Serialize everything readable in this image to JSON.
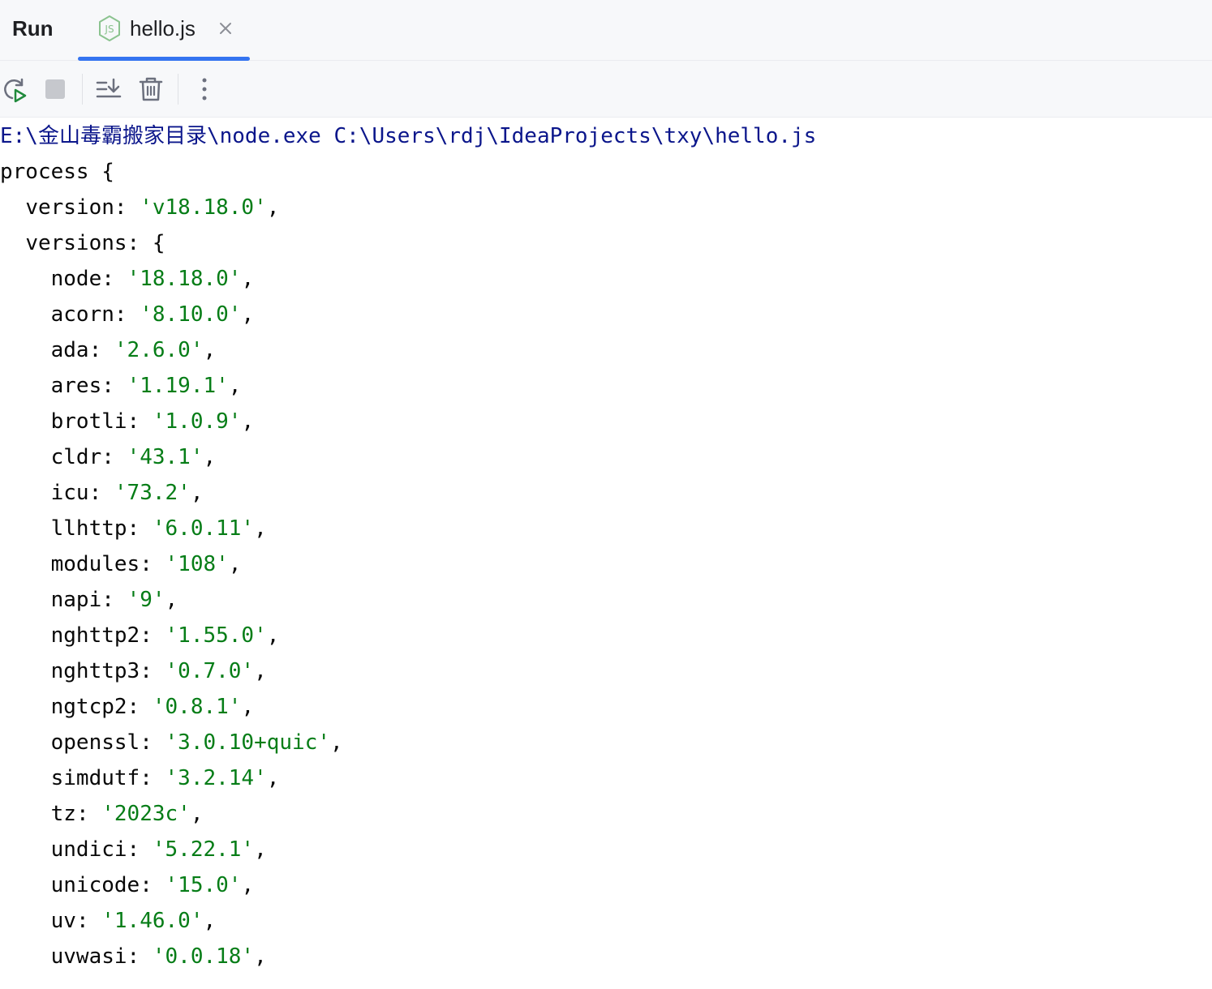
{
  "header": {
    "run_label": "Run",
    "tab": {
      "label": "hello.js",
      "icon": "nodejs-icon"
    }
  },
  "toolbar": {
    "buttons": [
      "rerun-icon",
      "stop-icon",
      "scroll-to-end-icon",
      "clear-all-icon",
      "more-icon"
    ]
  },
  "console": {
    "command": "E:\\金山毒霸搬家目录\\node.exe C:\\Users\\rdj\\IdeaProjects\\txy\\hello.js",
    "process_open": "process {",
    "version": {
      "key": "version",
      "value": "'v18.18.0'"
    },
    "versions_open": "versions: {",
    "entries": [
      {
        "key": "node",
        "value": "'18.18.0'"
      },
      {
        "key": "acorn",
        "value": "'8.10.0'"
      },
      {
        "key": "ada",
        "value": "'2.6.0'"
      },
      {
        "key": "ares",
        "value": "'1.19.1'"
      },
      {
        "key": "brotli",
        "value": "'1.0.9'"
      },
      {
        "key": "cldr",
        "value": "'43.1'"
      },
      {
        "key": "icu",
        "value": "'73.2'"
      },
      {
        "key": "llhttp",
        "value": "'6.0.11'"
      },
      {
        "key": "modules",
        "value": "'108'"
      },
      {
        "key": "napi",
        "value": "'9'"
      },
      {
        "key": "nghttp2",
        "value": "'1.55.0'"
      },
      {
        "key": "nghttp3",
        "value": "'0.7.0'"
      },
      {
        "key": "ngtcp2",
        "value": "'0.8.1'"
      },
      {
        "key": "openssl",
        "value": "'3.0.10+quic'"
      },
      {
        "key": "simdutf",
        "value": "'3.2.14'"
      },
      {
        "key": "tz",
        "value": "'2023c'"
      },
      {
        "key": "undici",
        "value": "'5.22.1'"
      },
      {
        "key": "unicode",
        "value": "'15.0'"
      },
      {
        "key": "uv",
        "value": "'1.46.0'"
      },
      {
        "key": "uvwasi",
        "value": "'0.0.18'"
      }
    ],
    "colors": {
      "command": "#0b168b",
      "string": "#067d17",
      "text": "#080808"
    }
  }
}
